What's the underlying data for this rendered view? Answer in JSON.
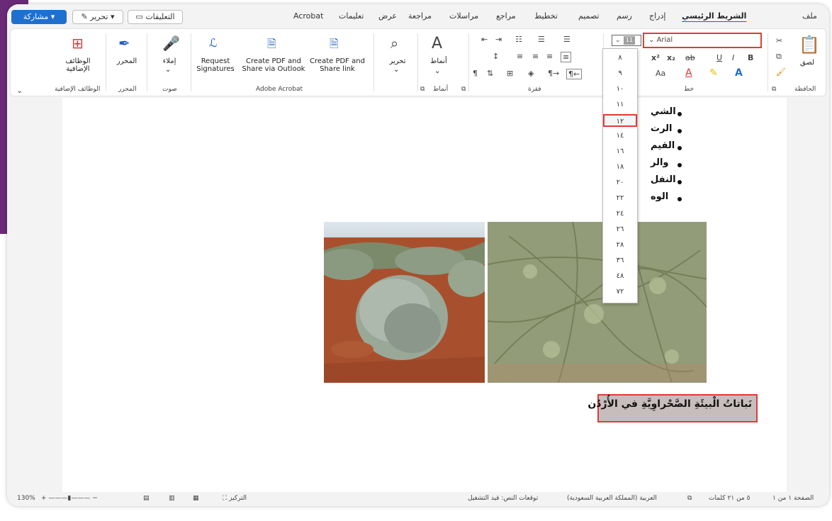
{
  "tabs": {
    "file": "ملف",
    "home": "الشريط الرئيسي",
    "insert": "إدراج",
    "draw": "رسم",
    "design": "تصميم",
    "layout": "تخطيط",
    "references": "مراجع",
    "mailings": "مراسلات",
    "review": "مراجعة",
    "view": "عرض",
    "help": "تعليمات",
    "acrobat": "Acrobat"
  },
  "top_buttons": {
    "share": "مشاركة",
    "editing": "تحرير",
    "comments": "التعليقات"
  },
  "ribbon": {
    "clipboard": {
      "paste": "لصق",
      "group": "الحافظة"
    },
    "font": {
      "name": "Arial",
      "size": "11",
      "group": "خط",
      "bold": "B",
      "italic": "I",
      "underline": "U",
      "superscript": "x²",
      "subscript": "x₂",
      "case": "Aa"
    },
    "paragraph": {
      "group": "فقرة"
    },
    "styles": {
      "label": "أنماط",
      "group": "أنماط"
    },
    "editing": {
      "label": "تحرير"
    },
    "acrobat": {
      "create_share_link": "Create PDF and Share link",
      "create_outlook": "Create PDF and Share via Outlook",
      "request_signatures": "Request Signatures",
      "group": "Adobe Acrobat"
    },
    "voice": {
      "dictate": "إملاء",
      "group": "صوت"
    },
    "editor": {
      "label": "المحرر",
      "group": "المحرر"
    },
    "addins": {
      "label": "الوظائف الإضافية",
      "group": "الوظائف الإضافية"
    }
  },
  "font_size_dropdown": {
    "options": [
      "٨",
      "٩",
      "١٠",
      "١١",
      "١٢",
      "١٤",
      "١٦",
      "١٨",
      "٢٠",
      "٢٢",
      "٢٤",
      "٢٦",
      "٢٨",
      "٣٦",
      "٤٨",
      "٧٢"
    ],
    "highlighted": "١٢"
  },
  "document": {
    "bullets": [
      "الشي",
      "الرت",
      "القيم",
      "والر",
      "النفل",
      "الوه"
    ],
    "caption": "نَباتاتُ الْبيئَةِ الصَّحْراوِيَّةِ في الأُرْدُن"
  },
  "status_bar": {
    "page": "الصفحة ١ من ١",
    "words": "٥ من ٢١ كلمات",
    "language": "العربية (المملكة العربية السعودية)",
    "predictions": "توقعات النص: قيد التشغيل",
    "focus": "التركيز",
    "zoom": "130%"
  }
}
